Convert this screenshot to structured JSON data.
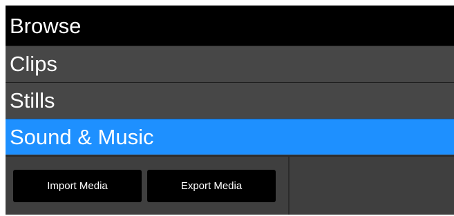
{
  "browse_panel": {
    "header": "Browse",
    "items": [
      {
        "label": "Clips",
        "selected": false
      },
      {
        "label": "Stills",
        "selected": false
      },
      {
        "label": "Sound & Music",
        "selected": true
      }
    ],
    "buttons": {
      "import_label": "Import Media",
      "export_label": "Export Media"
    }
  },
  "colors": {
    "header_bg": "#000000",
    "item_bg": "#474747",
    "selected_bg": "#1e90ff",
    "button_bg": "#000000",
    "text": "#ffffff"
  }
}
